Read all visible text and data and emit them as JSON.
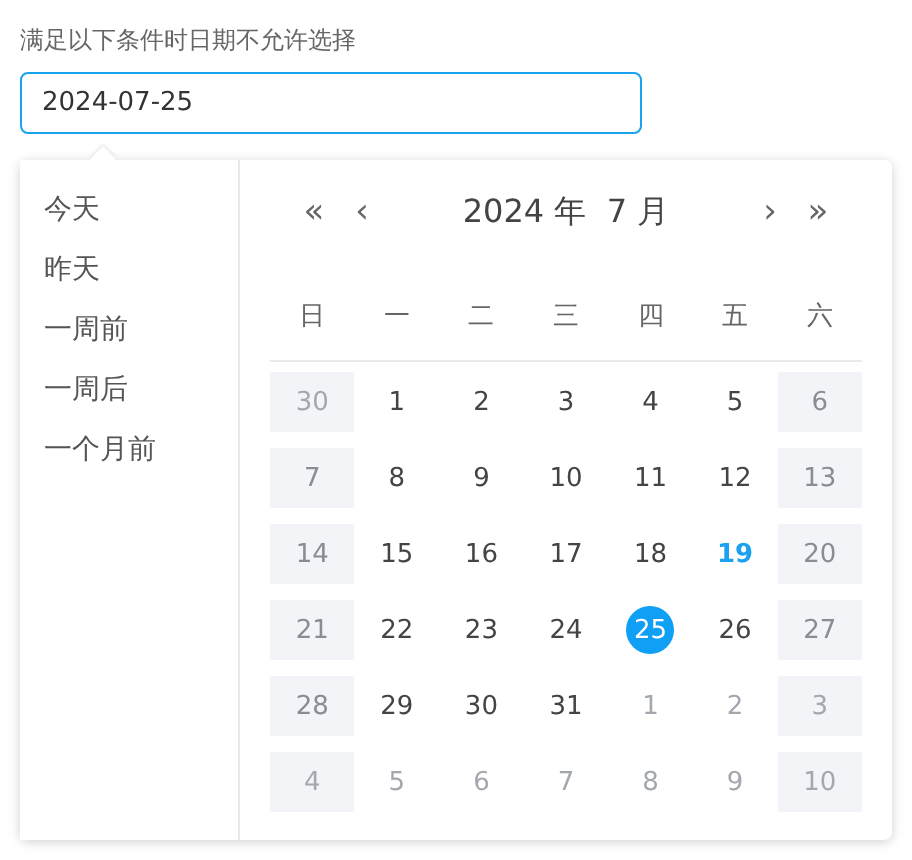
{
  "label": "满足以下条件时日期不允许选择",
  "input": {
    "value": "2024-07-25"
  },
  "shortcuts": [
    "今天",
    "昨天",
    "一周前",
    "一周后",
    "一个月前"
  ],
  "header": {
    "prev_year": "«",
    "prev_month": "‹",
    "title": "2024 年  7 月",
    "next_month": "›",
    "next_year": "»"
  },
  "weekdays": [
    "日",
    "一",
    "二",
    "三",
    "四",
    "五",
    "六"
  ],
  "weeks": [
    [
      {
        "text": "30",
        "disabled": true,
        "other_month": true,
        "today": false,
        "selected": false
      },
      {
        "text": "1",
        "disabled": false,
        "other_month": false,
        "today": false,
        "selected": false
      },
      {
        "text": "2",
        "disabled": false,
        "other_month": false,
        "today": false,
        "selected": false
      },
      {
        "text": "3",
        "disabled": false,
        "other_month": false,
        "today": false,
        "selected": false
      },
      {
        "text": "4",
        "disabled": false,
        "other_month": false,
        "today": false,
        "selected": false
      },
      {
        "text": "5",
        "disabled": false,
        "other_month": false,
        "today": false,
        "selected": false
      },
      {
        "text": "6",
        "disabled": true,
        "other_month": false,
        "today": false,
        "selected": false
      }
    ],
    [
      {
        "text": "7",
        "disabled": true,
        "other_month": false,
        "today": false,
        "selected": false
      },
      {
        "text": "8",
        "disabled": false,
        "other_month": false,
        "today": false,
        "selected": false
      },
      {
        "text": "9",
        "disabled": false,
        "other_month": false,
        "today": false,
        "selected": false
      },
      {
        "text": "10",
        "disabled": false,
        "other_month": false,
        "today": false,
        "selected": false
      },
      {
        "text": "11",
        "disabled": false,
        "other_month": false,
        "today": false,
        "selected": false
      },
      {
        "text": "12",
        "disabled": false,
        "other_month": false,
        "today": false,
        "selected": false
      },
      {
        "text": "13",
        "disabled": true,
        "other_month": false,
        "today": false,
        "selected": false
      }
    ],
    [
      {
        "text": "14",
        "disabled": true,
        "other_month": false,
        "today": false,
        "selected": false
      },
      {
        "text": "15",
        "disabled": false,
        "other_month": false,
        "today": false,
        "selected": false
      },
      {
        "text": "16",
        "disabled": false,
        "other_month": false,
        "today": false,
        "selected": false
      },
      {
        "text": "17",
        "disabled": false,
        "other_month": false,
        "today": false,
        "selected": false
      },
      {
        "text": "18",
        "disabled": false,
        "other_month": false,
        "today": false,
        "selected": false
      },
      {
        "text": "19",
        "disabled": false,
        "other_month": false,
        "today": true,
        "selected": false
      },
      {
        "text": "20",
        "disabled": true,
        "other_month": false,
        "today": false,
        "selected": false
      }
    ],
    [
      {
        "text": "21",
        "disabled": true,
        "other_month": false,
        "today": false,
        "selected": false
      },
      {
        "text": "22",
        "disabled": false,
        "other_month": false,
        "today": false,
        "selected": false
      },
      {
        "text": "23",
        "disabled": false,
        "other_month": false,
        "today": false,
        "selected": false
      },
      {
        "text": "24",
        "disabled": false,
        "other_month": false,
        "today": false,
        "selected": false
      },
      {
        "text": "25",
        "disabled": false,
        "other_month": false,
        "today": false,
        "selected": true
      },
      {
        "text": "26",
        "disabled": false,
        "other_month": false,
        "today": false,
        "selected": false
      },
      {
        "text": "27",
        "disabled": true,
        "other_month": false,
        "today": false,
        "selected": false
      }
    ],
    [
      {
        "text": "28",
        "disabled": true,
        "other_month": false,
        "today": false,
        "selected": false
      },
      {
        "text": "29",
        "disabled": false,
        "other_month": false,
        "today": false,
        "selected": false
      },
      {
        "text": "30",
        "disabled": false,
        "other_month": false,
        "today": false,
        "selected": false
      },
      {
        "text": "31",
        "disabled": false,
        "other_month": false,
        "today": false,
        "selected": false
      },
      {
        "text": "1",
        "disabled": false,
        "other_month": true,
        "today": false,
        "selected": false
      },
      {
        "text": "2",
        "disabled": false,
        "other_month": true,
        "today": false,
        "selected": false
      },
      {
        "text": "3",
        "disabled": true,
        "other_month": true,
        "today": false,
        "selected": false
      }
    ],
    [
      {
        "text": "4",
        "disabled": true,
        "other_month": true,
        "today": false,
        "selected": false
      },
      {
        "text": "5",
        "disabled": false,
        "other_month": true,
        "today": false,
        "selected": false
      },
      {
        "text": "6",
        "disabled": false,
        "other_month": true,
        "today": false,
        "selected": false
      },
      {
        "text": "7",
        "disabled": false,
        "other_month": true,
        "today": false,
        "selected": false
      },
      {
        "text": "8",
        "disabled": false,
        "other_month": true,
        "today": false,
        "selected": false
      },
      {
        "text": "9",
        "disabled": false,
        "other_month": true,
        "today": false,
        "selected": false
      },
      {
        "text": "10",
        "disabled": true,
        "other_month": true,
        "today": false,
        "selected": false
      }
    ]
  ]
}
